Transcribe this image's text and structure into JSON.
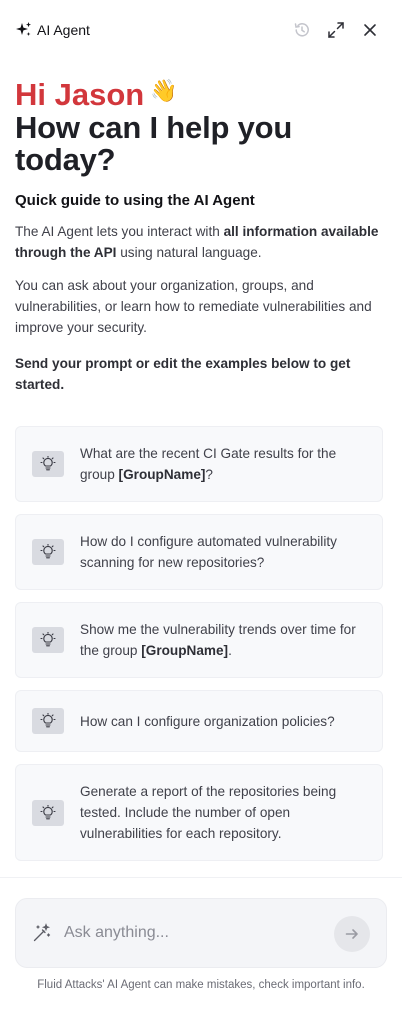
{
  "header": {
    "title": "AI Agent",
    "icons": {
      "brand": "sparkles-icon",
      "history": "history-icon",
      "expand": "expand-icon",
      "close": "close-icon"
    }
  },
  "greeting": {
    "hi": "Hi Jason",
    "emoji": "👋",
    "headline": "How can I help you today?"
  },
  "guide": {
    "title": "Quick guide to using the AI Agent",
    "p1_pre": "The AI Agent lets you interact with ",
    "p1_bold": "all information available through the API",
    "p1_post": " using natural language.",
    "p2": "You can ask about your organization, groups, and vulnerabilities, or learn how to remediate vulnerabilities and improve your security.",
    "p3": "Send your prompt or edit the examples below to get started."
  },
  "suggestions": [
    {
      "pre": "What are the recent CI Gate results for the group ",
      "bold": "[GroupName]",
      "post": "?",
      "icon": "lightbulb-icon"
    },
    {
      "pre": "How do I configure automated vulnerability scanning for new repositories?",
      "bold": "",
      "post": "",
      "icon": "lightbulb-icon"
    },
    {
      "pre": "Show me the vulnerability trends over time for the group ",
      "bold": "[GroupName]",
      "post": ".",
      "icon": "lightbulb-icon"
    },
    {
      "pre": "How can I configure organization policies?",
      "bold": "",
      "post": "",
      "icon": "lightbulb-icon"
    },
    {
      "pre": "Generate a report of the repositories being tested. Include the number of open vulnerabilities for each repository.",
      "bold": "",
      "post": "",
      "icon": "lightbulb-icon"
    }
  ],
  "prompt": {
    "placeholder": "Ask anything...",
    "value": "",
    "icons": {
      "wand": "magic-wand-icon",
      "send": "arrow-right-icon"
    }
  },
  "footer": {
    "disclaimer": "Fluid Attacks' AI Agent can make mistakes, check important info."
  },
  "colors": {
    "accent": "#d2373c",
    "heading": "#1f2026",
    "card_bg": "#f8f9fb"
  }
}
